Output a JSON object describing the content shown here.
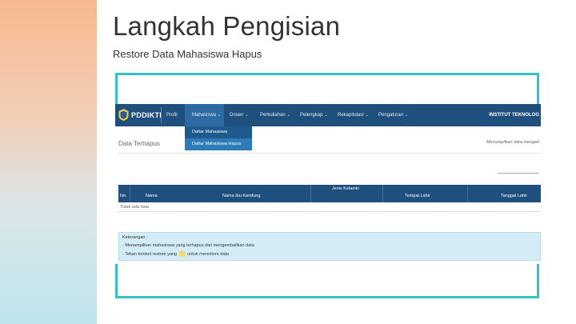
{
  "slide": {
    "title": "Langkah Pengisian",
    "subtitle": "Restore Data Mahasiswa Hapus"
  },
  "app": {
    "brand": "PDDIKTI",
    "institution": "INSTITUT TEKNOLOG",
    "nav": [
      "Profil",
      "Mahasiswa",
      "Dosen",
      "Perkuliahan",
      "Pelengkap",
      "Rekapitulasi",
      "Pengaturan"
    ],
    "dropdown": [
      "Daftar Mahasiswa",
      "Daftar Mahasiswa Hapus"
    ],
    "page_title": "Data Terhapus",
    "view_link": "Menampilkan data mengeti",
    "table": {
      "headers": [
        "No.",
        "Nama",
        "Nama Ibu Kandung",
        "Jenis Kelamin",
        "Tempat Lahir",
        "Tanggal Lahir"
      ],
      "empty_text": "Tidak ada data"
    },
    "info": {
      "title": "Keterangan :",
      "line1": "- Menampilkan mahasiswa yang terhapus dari mengembalikan data",
      "line2_before": "- Tekan tombol restore yang",
      "line2_after": "untuk merestore data"
    }
  },
  "colors": {
    "accent_border": "#35c1cc",
    "navbar": "#1f4f7d",
    "info_box": "#d3ecf6"
  }
}
